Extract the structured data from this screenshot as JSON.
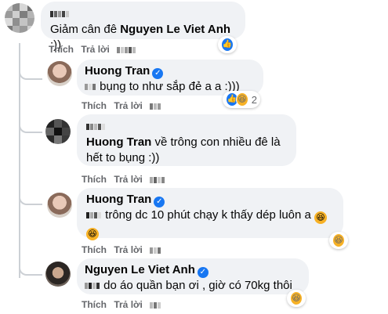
{
  "comments": [
    {
      "author": "",
      "text_bold": "",
      "text": "Giảm cân đê ",
      "mention": "Nguyen Le Viet Anh",
      "tail": " :))",
      "like_label": "Thích",
      "reply_label": "Trả lời",
      "reaction_icons": [
        "like-icon"
      ],
      "reaction_count": ""
    },
    {
      "author": "Huong Tran",
      "text": " bụng to như sắp đẻ a a :)))",
      "like_label": "Thích",
      "reply_label": "Trả lời",
      "reaction_icons": [
        "like-icon",
        "haha-icon"
      ],
      "reaction_count": "2"
    },
    {
      "author": "",
      "mention": "Huong Tran",
      "text": " về trông con nhiều đê là hết to bụng :))",
      "like_label": "Thích",
      "reply_label": "Trả lời"
    },
    {
      "author": "Huong Tran",
      "text": " trông dc 10 phút chạy k thấy dép luôn a ",
      "like_label": "Thích",
      "reply_label": "Trả lời",
      "reaction_icons": [
        "haha-icon"
      ]
    },
    {
      "author": "Nguyen Le Viet Anh",
      "text": " do áo quần bạn ơi , giờ có 70kg thôi",
      "like_label": "Thích",
      "reply_label": "Trả lời",
      "reaction_icons": [
        "haha-icon"
      ]
    }
  ],
  "colors": {
    "bubble": "#f0f2f5",
    "accent": "#1877f2",
    "meta": "#65676b",
    "haha": "#f7b125"
  }
}
